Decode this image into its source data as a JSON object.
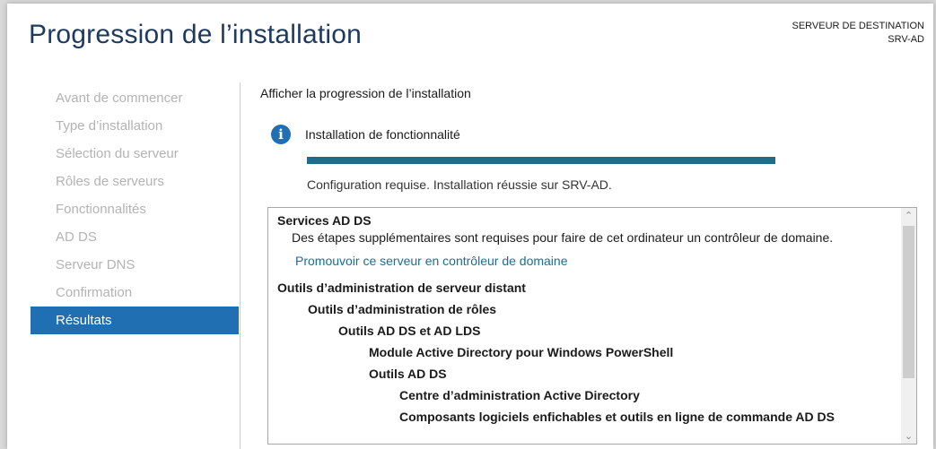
{
  "header": {
    "title": "Progression de l’installation",
    "dest_label": "SERVEUR DE DESTINATION",
    "dest_name": "SRV-AD"
  },
  "sidebar": {
    "items": [
      {
        "label": "Avant de commencer"
      },
      {
        "label": "Type d’installation"
      },
      {
        "label": "Sélection du serveur"
      },
      {
        "label": "Rôles de serveurs"
      },
      {
        "label": "Fonctionnalités"
      },
      {
        "label": "AD DS"
      },
      {
        "label": "Serveur DNS"
      },
      {
        "label": "Confirmation"
      },
      {
        "label": "Résultats",
        "active": true
      }
    ]
  },
  "main": {
    "section_label": "Afficher la progression de l’installation",
    "info_icon": "info-icon",
    "info_text": "Installation de fonctionnalité",
    "progress": 1.0,
    "status_text": "Configuration requise. Installation réussie sur SRV-AD.",
    "results": {
      "heading": "Services AD DS",
      "description": "Des étapes supplémentaires sont requises pour faire de cet ordinateur un contrôleur de domaine.",
      "link": "Promouvoir ce serveur en contrôleur de domaine",
      "tree": [
        {
          "label": "Outils d’administration de serveur distant",
          "level": 0
        },
        {
          "label": "Outils d’administration de rôles",
          "level": 1
        },
        {
          "label": "Outils AD DS et AD LDS",
          "level": 2
        },
        {
          "label": "Module Active Directory pour Windows PowerShell",
          "level": 3
        },
        {
          "label": "Outils AD DS",
          "level": 3
        },
        {
          "label": "Centre d’administration Active Directory",
          "level": 4
        },
        {
          "label": "Composants logiciels enfichables et outils en ligne de commande AD DS",
          "level": 4
        }
      ]
    }
  },
  "colors": {
    "accent": "#1f6fb2",
    "progress": "#1d6e8a",
    "link": "#1a6f94",
    "title": "#1e3a5f"
  }
}
